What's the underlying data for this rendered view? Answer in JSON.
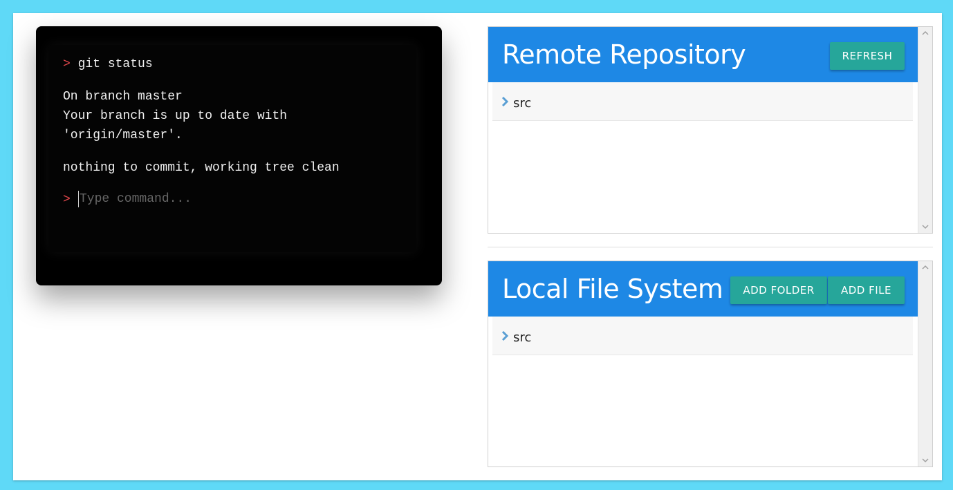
{
  "terminal": {
    "history": [
      {
        "type": "command",
        "prompt": ">",
        "text": "git status"
      },
      {
        "type": "output",
        "text": "On branch master"
      },
      {
        "type": "output",
        "text": "Your branch is up to date with"
      },
      {
        "type": "output",
        "text": "'origin/master'."
      },
      {
        "type": "output",
        "text": "nothing to commit, working tree clean"
      }
    ],
    "input_prompt": ">",
    "input_placeholder": "Type command...",
    "input_value": ""
  },
  "remote": {
    "title": "Remote Repository",
    "refresh_label": "REFRESH",
    "items": [
      {
        "label": "src",
        "icon": "chevron-right-icon"
      }
    ]
  },
  "local": {
    "title": "Local File System",
    "add_folder_label": "ADD FOLDER",
    "add_file_label": "ADD FILE",
    "items": [
      {
        "label": "src",
        "icon": "chevron-right-icon"
      }
    ]
  },
  "colors": {
    "page_bg": "#5fd9f7",
    "header_blue": "#1e88e5",
    "button_teal": "#26a69a",
    "prompt_red": "#e5484d",
    "chevron_blue": "#5a9fd4"
  }
}
